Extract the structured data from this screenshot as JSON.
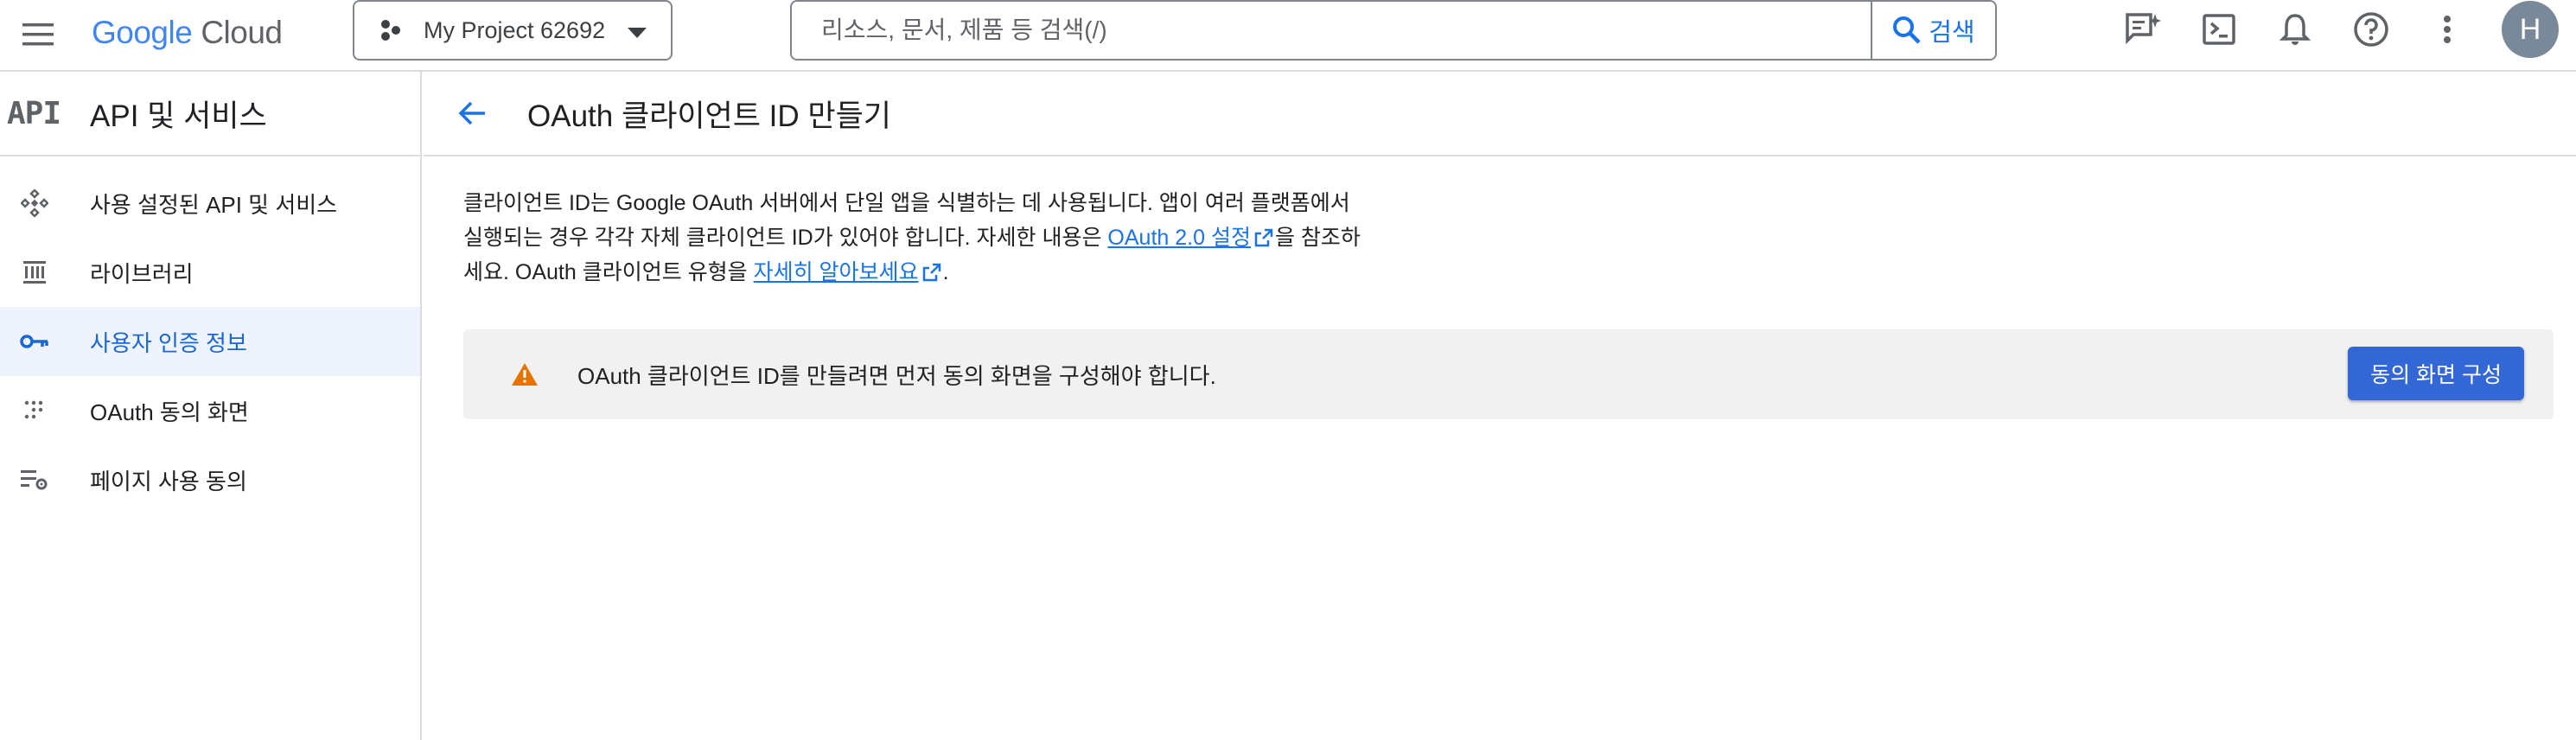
{
  "topbar": {
    "logo_google": "Google",
    "logo_cloud": "Cloud",
    "project_name": "My Project 62692",
    "search_placeholder": "리소스, 문서, 제품 등 검색(/)",
    "search_button": "검색",
    "avatar_letter": "H",
    "icons": [
      "menu-icon",
      "project-icon",
      "dropdown-caret-icon",
      "search-icon",
      "feedback-icon",
      "cloud-shell-icon",
      "notifications-icon",
      "help-icon",
      "more-vert-icon"
    ]
  },
  "sidebar": {
    "badge": "API",
    "title": "API 및 서비스",
    "items": [
      {
        "label": "사용 설정된 API 및 서비스",
        "icon": "api-hub-icon",
        "active": false
      },
      {
        "label": "라이브러리",
        "icon": "library-icon",
        "active": false
      },
      {
        "label": "사용자 인증 정보",
        "icon": "key-icon",
        "active": true
      },
      {
        "label": "OAuth 동의 화면",
        "icon": "consent-dots-icon",
        "active": false
      },
      {
        "label": "페이지 사용 동의",
        "icon": "settings-list-icon",
        "active": false
      }
    ]
  },
  "main": {
    "title": "OAuth 클라이언트 ID 만들기",
    "desc": {
      "p1": "클라이언트 ID는 Google OAuth 서버에서 단일 앱을 식별하는 데 사용됩니다. 앱이 여러 플랫폼에서",
      "p2": "실행되는 경우 각각 자체 클라이언트 ID가 있어야 합니다. 자세한 내용은 ",
      "link1": "OAuth 2.0 설정",
      "p3": "을 참조하",
      "p4": "세요. OAuth 클라이언트 유형을 ",
      "link2": "자세히 알아보세요",
      "p5": "."
    },
    "banner": {
      "text": "OAuth 클라이언트 ID를 만들려면 먼저 동의 화면을 구성해야 합니다.",
      "button": "동의 화면 구성"
    }
  },
  "colors": {
    "accent": "#1a73e8",
    "active_bg": "#eef3fd",
    "warning": "#e37400",
    "button": "#3367d6"
  }
}
